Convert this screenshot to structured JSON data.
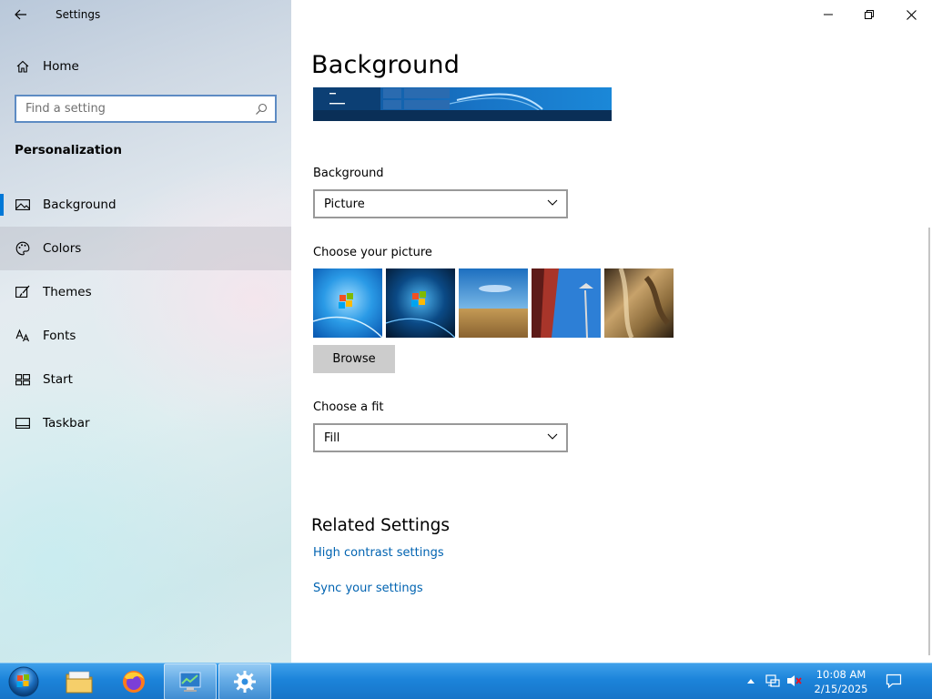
{
  "window": {
    "app_title": "Settings",
    "controls": [
      "minimize",
      "restore",
      "close"
    ]
  },
  "sidebar": {
    "home_label": "Home",
    "search_placeholder": "Find a setting",
    "section_title": "Personalization",
    "items": [
      {
        "label": "Background",
        "icon": "picture-icon",
        "selected": true
      },
      {
        "label": "Colors",
        "icon": "palette-icon",
        "hover": true
      },
      {
        "label": "Themes",
        "icon": "brush-icon"
      },
      {
        "label": "Fonts",
        "icon": "font-icon"
      },
      {
        "label": "Start",
        "icon": "start-icon"
      },
      {
        "label": "Taskbar",
        "icon": "taskbar-icon"
      }
    ]
  },
  "main": {
    "page_title": "Background",
    "background_label": "Background",
    "background_value": "Picture",
    "choose_picture_label": "Choose your picture",
    "pictures": [
      "windows-7-wallpaper-light",
      "windows-7-wallpaper-dark",
      "wheat-field",
      "seattle-space-needle",
      "saxophone-closeup"
    ],
    "browse_label": "Browse",
    "fit_label": "Choose a fit",
    "fit_value": "Fill",
    "related_title": "Related Settings",
    "links": [
      "High contrast settings",
      "Sync your settings"
    ]
  },
  "taskbar": {
    "apps": [
      "file-explorer-icon",
      "firefox-icon",
      "control-panel-icon",
      "settings-gear-icon"
    ],
    "time": "10:08 AM",
    "date": "2/15/2025"
  },
  "colors": {
    "accent": "#0078d7",
    "link": "#0063b1",
    "taskbar": "#1c84da"
  }
}
